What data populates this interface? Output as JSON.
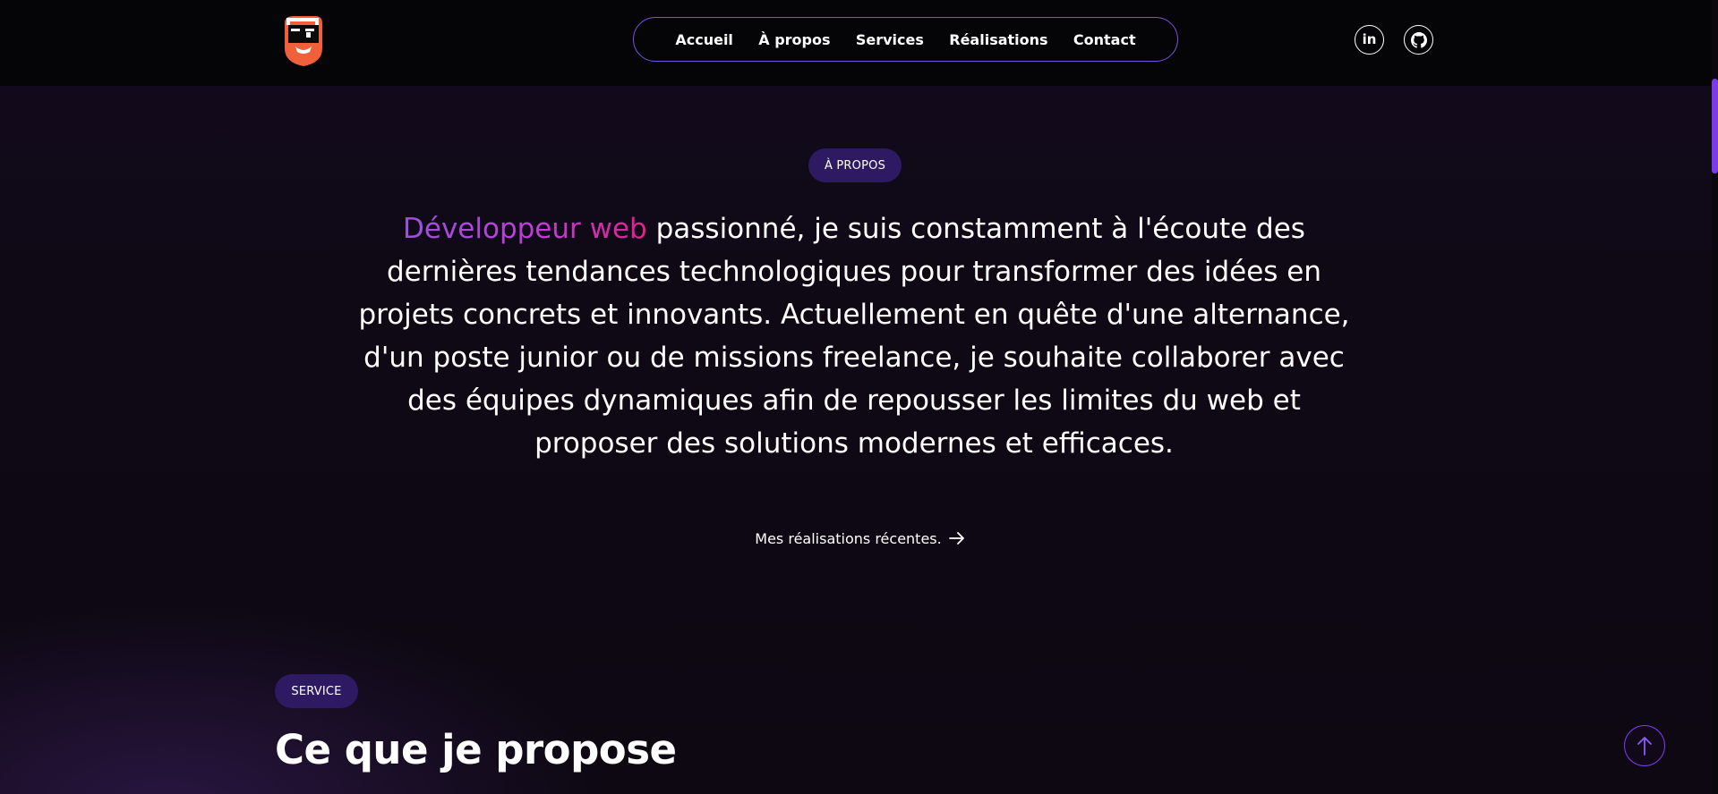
{
  "header": {
    "logo_icon": "bearded-face-logo-icon",
    "nav": [
      {
        "label": "Accueil"
      },
      {
        "label": "À propos"
      },
      {
        "label": "Services"
      },
      {
        "label": "Réalisations"
      },
      {
        "label": "Contact"
      }
    ],
    "social": [
      {
        "icon": "linkedin-icon",
        "label": "in"
      },
      {
        "icon": "github-icon"
      }
    ]
  },
  "about": {
    "badge": "À PROPOS",
    "highlight": "Développeur web",
    "text": " passionné, je suis constamment à l'écoute des dernières tendances technologiques pour transformer des idées en projets concrets et innovants. Actuellement en quête d'une alternance, d'un poste junior ou de missions freelance, je souhaite collaborer avec des équipes dynamiques afin de repousser les limites du web et proposer des solutions modernes et efficaces.",
    "link_label": "Mes réalisations récentes.",
    "link_icon": "arrow-right-icon"
  },
  "services": {
    "badge": "SERVICE",
    "title": "Ce que je propose"
  },
  "scroll_top_icon": "arrow-up-icon",
  "colors": {
    "accent": "#7c3aed",
    "badge_bg": "#2e1a63",
    "header_bg": "#050507",
    "gradient_start": "#9b51e0",
    "gradient_end": "#e0218a",
    "logo_orange": "#f0603a"
  }
}
